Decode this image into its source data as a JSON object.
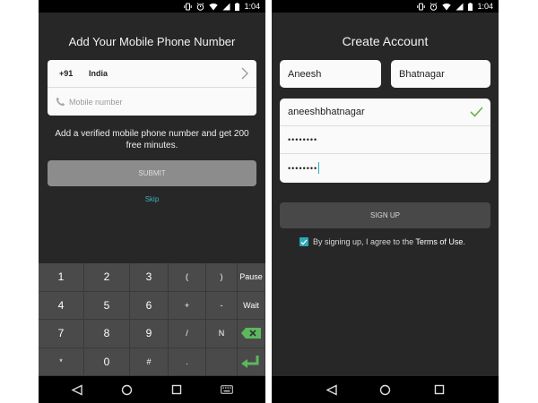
{
  "status_bar": {
    "time": "1:04"
  },
  "left_screen": {
    "title": "Add Your Mobile Phone Number",
    "country": {
      "dial_code": "+91",
      "name": "India"
    },
    "phone_input": {
      "placeholder": "Mobile number",
      "value": ""
    },
    "info": "Add a verified mobile phone number and get 200 free minutes.",
    "submit_label": "SUBMIT",
    "skip_label": "Skip",
    "keypad_rows": [
      [
        "1",
        "2",
        "3",
        "(",
        ")",
        "Pause"
      ],
      [
        "4",
        "5",
        "6",
        "+",
        "-",
        "Wait"
      ],
      [
        "7",
        "8",
        "9",
        "/",
        "N",
        "backspace"
      ],
      [
        "*",
        "0",
        "#",
        ".",
        "",
        "enter"
      ]
    ]
  },
  "right_screen": {
    "title": "Create Account",
    "first_name": "Aneesh",
    "last_name": "Bhatnagar",
    "username": "aneeshbhatnagar",
    "password_mask": "••••••••",
    "confirm_mask": "••••••••",
    "signup_label": "SIGN UP",
    "terms_prefix": "By signing up, I agree to the ",
    "terms_link": "Terms of Use",
    "terms_suffix": ".",
    "terms_checked": true
  },
  "colors": {
    "accent": "#2aa9b8",
    "skip_link": "#3fb1be",
    "check_green": "#6ab04c",
    "keypad_action_green": "#5cb85c",
    "screen_bg": "#272727",
    "keypad_bg": "#4a4a4a"
  },
  "icons": {
    "status": [
      "vibrate-icon",
      "alarm-icon",
      "wifi-icon",
      "cellular-signal-icon",
      "battery-icon"
    ],
    "nav": [
      "back-icon",
      "home-icon",
      "recents-icon",
      "keyboard-icon"
    ]
  }
}
